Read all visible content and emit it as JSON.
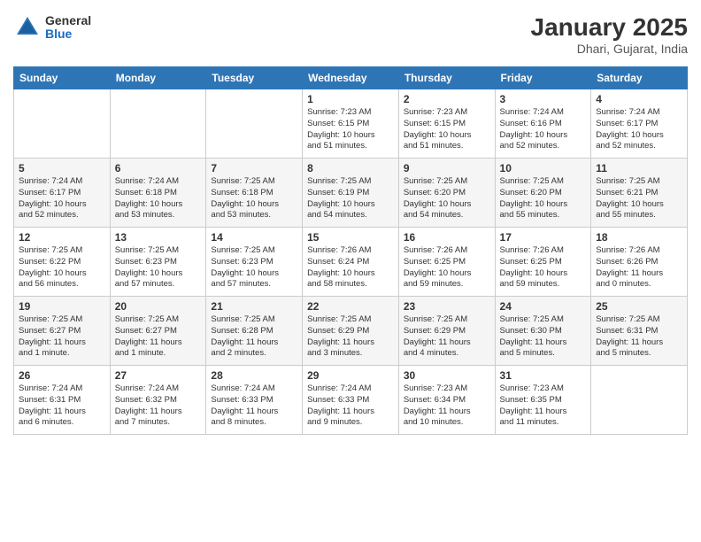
{
  "logo": {
    "general": "General",
    "blue": "Blue"
  },
  "title": "January 2025",
  "subtitle": "Dhari, Gujarat, India",
  "days_of_week": [
    "Sunday",
    "Monday",
    "Tuesday",
    "Wednesday",
    "Thursday",
    "Friday",
    "Saturday"
  ],
  "weeks": [
    [
      {
        "day": "",
        "info": ""
      },
      {
        "day": "",
        "info": ""
      },
      {
        "day": "",
        "info": ""
      },
      {
        "day": "1",
        "info": "Sunrise: 7:23 AM\nSunset: 6:15 PM\nDaylight: 10 hours\nand 51 minutes."
      },
      {
        "day": "2",
        "info": "Sunrise: 7:23 AM\nSunset: 6:15 PM\nDaylight: 10 hours\nand 51 minutes."
      },
      {
        "day": "3",
        "info": "Sunrise: 7:24 AM\nSunset: 6:16 PM\nDaylight: 10 hours\nand 52 minutes."
      },
      {
        "day": "4",
        "info": "Sunrise: 7:24 AM\nSunset: 6:17 PM\nDaylight: 10 hours\nand 52 minutes."
      }
    ],
    [
      {
        "day": "5",
        "info": "Sunrise: 7:24 AM\nSunset: 6:17 PM\nDaylight: 10 hours\nand 52 minutes."
      },
      {
        "day": "6",
        "info": "Sunrise: 7:24 AM\nSunset: 6:18 PM\nDaylight: 10 hours\nand 53 minutes."
      },
      {
        "day": "7",
        "info": "Sunrise: 7:25 AM\nSunset: 6:18 PM\nDaylight: 10 hours\nand 53 minutes."
      },
      {
        "day": "8",
        "info": "Sunrise: 7:25 AM\nSunset: 6:19 PM\nDaylight: 10 hours\nand 54 minutes."
      },
      {
        "day": "9",
        "info": "Sunrise: 7:25 AM\nSunset: 6:20 PM\nDaylight: 10 hours\nand 54 minutes."
      },
      {
        "day": "10",
        "info": "Sunrise: 7:25 AM\nSunset: 6:20 PM\nDaylight: 10 hours\nand 55 minutes."
      },
      {
        "day": "11",
        "info": "Sunrise: 7:25 AM\nSunset: 6:21 PM\nDaylight: 10 hours\nand 55 minutes."
      }
    ],
    [
      {
        "day": "12",
        "info": "Sunrise: 7:25 AM\nSunset: 6:22 PM\nDaylight: 10 hours\nand 56 minutes."
      },
      {
        "day": "13",
        "info": "Sunrise: 7:25 AM\nSunset: 6:23 PM\nDaylight: 10 hours\nand 57 minutes."
      },
      {
        "day": "14",
        "info": "Sunrise: 7:25 AM\nSunset: 6:23 PM\nDaylight: 10 hours\nand 57 minutes."
      },
      {
        "day": "15",
        "info": "Sunrise: 7:26 AM\nSunset: 6:24 PM\nDaylight: 10 hours\nand 58 minutes."
      },
      {
        "day": "16",
        "info": "Sunrise: 7:26 AM\nSunset: 6:25 PM\nDaylight: 10 hours\nand 59 minutes."
      },
      {
        "day": "17",
        "info": "Sunrise: 7:26 AM\nSunset: 6:25 PM\nDaylight: 10 hours\nand 59 minutes."
      },
      {
        "day": "18",
        "info": "Sunrise: 7:26 AM\nSunset: 6:26 PM\nDaylight: 11 hours\nand 0 minutes."
      }
    ],
    [
      {
        "day": "19",
        "info": "Sunrise: 7:25 AM\nSunset: 6:27 PM\nDaylight: 11 hours\nand 1 minute."
      },
      {
        "day": "20",
        "info": "Sunrise: 7:25 AM\nSunset: 6:27 PM\nDaylight: 11 hours\nand 1 minute."
      },
      {
        "day": "21",
        "info": "Sunrise: 7:25 AM\nSunset: 6:28 PM\nDaylight: 11 hours\nand 2 minutes."
      },
      {
        "day": "22",
        "info": "Sunrise: 7:25 AM\nSunset: 6:29 PM\nDaylight: 11 hours\nand 3 minutes."
      },
      {
        "day": "23",
        "info": "Sunrise: 7:25 AM\nSunset: 6:29 PM\nDaylight: 11 hours\nand 4 minutes."
      },
      {
        "day": "24",
        "info": "Sunrise: 7:25 AM\nSunset: 6:30 PM\nDaylight: 11 hours\nand 5 minutes."
      },
      {
        "day": "25",
        "info": "Sunrise: 7:25 AM\nSunset: 6:31 PM\nDaylight: 11 hours\nand 5 minutes."
      }
    ],
    [
      {
        "day": "26",
        "info": "Sunrise: 7:24 AM\nSunset: 6:31 PM\nDaylight: 11 hours\nand 6 minutes."
      },
      {
        "day": "27",
        "info": "Sunrise: 7:24 AM\nSunset: 6:32 PM\nDaylight: 11 hours\nand 7 minutes."
      },
      {
        "day": "28",
        "info": "Sunrise: 7:24 AM\nSunset: 6:33 PM\nDaylight: 11 hours\nand 8 minutes."
      },
      {
        "day": "29",
        "info": "Sunrise: 7:24 AM\nSunset: 6:33 PM\nDaylight: 11 hours\nand 9 minutes."
      },
      {
        "day": "30",
        "info": "Sunrise: 7:23 AM\nSunset: 6:34 PM\nDaylight: 11 hours\nand 10 minutes."
      },
      {
        "day": "31",
        "info": "Sunrise: 7:23 AM\nSunset: 6:35 PM\nDaylight: 11 hours\nand 11 minutes."
      },
      {
        "day": "",
        "info": ""
      }
    ]
  ]
}
